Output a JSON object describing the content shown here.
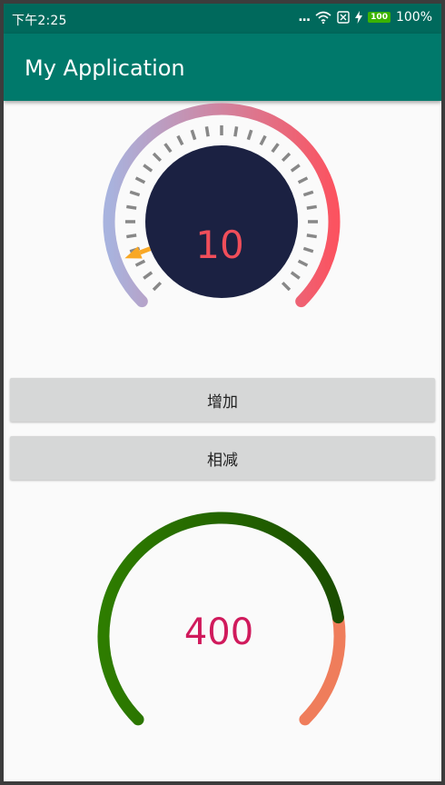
{
  "status_bar": {
    "time": "下午2:25",
    "dots": "...",
    "battery_level": "100",
    "battery_percent": "100%"
  },
  "app_bar": {
    "title": "My Application"
  },
  "gauge_top": {
    "value": "10",
    "value_color": "#f04e5a",
    "dial_color": "#1b2142",
    "arc_start_color": "#a8b3de",
    "arc_end_color": "#fb5360",
    "pointer_color": "#f9a825",
    "tick_color": "#888888",
    "pointer_level": 0.09
  },
  "buttons": {
    "add_label": "增加",
    "subtract_label": "相减"
  },
  "gauge_bottom": {
    "value": "400",
    "value_color": "#d01a5c",
    "progress_start_color": "#2e7d00",
    "progress_end_color": "#1a4d00",
    "remaining_color": "#ef7d5b",
    "progress_level": 0.8
  }
}
